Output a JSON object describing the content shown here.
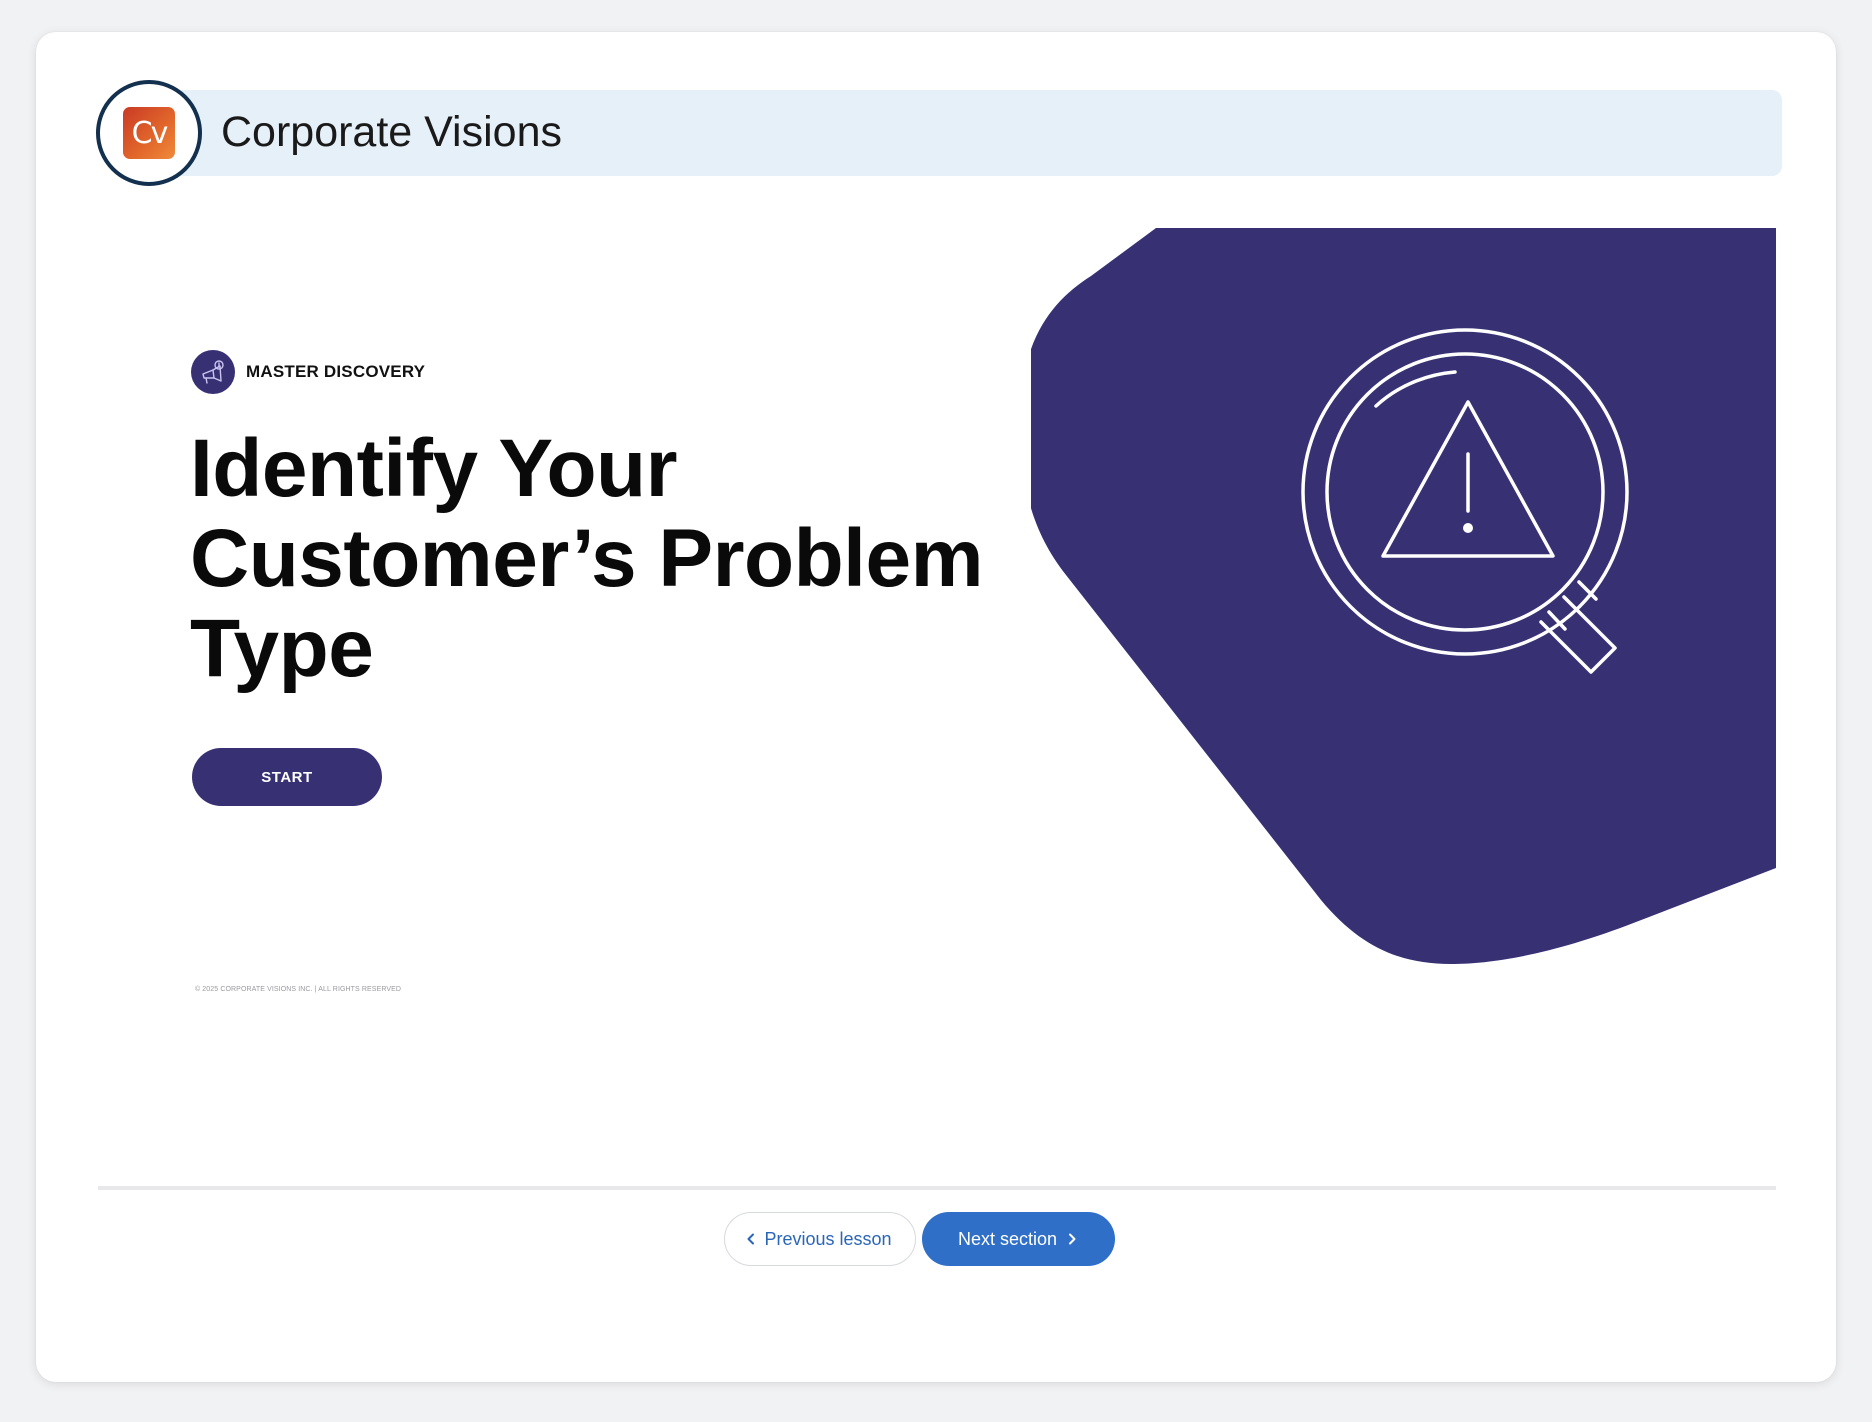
{
  "header": {
    "brand_title": "Corporate Visions",
    "logo_text": "Cv",
    "logo_icon": "corporate-visions-logo"
  },
  "lesson": {
    "kicker": "MASTER DISCOVERY",
    "kicker_icon": "megaphone-dollar-icon",
    "title": "Identify Your Customer’s Problem Type",
    "start_label": "START",
    "copyright": "© 2025 CORPORATE VISIONS INC. | ALL RIGHTS RESERVED",
    "hero_icon": "magnifier-warning-icon"
  },
  "navigation": {
    "prev_label": "Previous lesson",
    "next_label": "Next section"
  },
  "colors": {
    "brand_purple": "#373174",
    "nav_blue": "#2f6fc8",
    "header_tint": "#e6f0f9",
    "logo_orange": "#e2682b"
  }
}
